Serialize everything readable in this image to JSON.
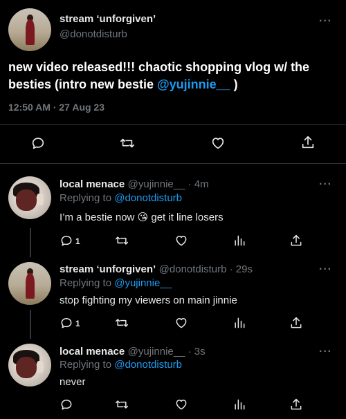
{
  "main_tweet": {
    "display_name": "stream ‘unforgiven’",
    "handle": "@donotdisturb",
    "text_before": "new video released!!! chaotic shopping vlog w/ the besties (intro new bestie ",
    "mention": "@yujinnie__",
    "text_after": " )",
    "timestamp": "12:50 AM · 27 Aug 23"
  },
  "replies": [
    {
      "display_name": "local menace",
      "meta": "@yujinnie__ · 4m",
      "replying_label": "Replying to ",
      "replying_to": "@donotdisturb",
      "text": "I’m a bestie now 😘  get it line losers",
      "reply_count": "1"
    },
    {
      "display_name": "stream ‘unforgiven’",
      "meta": "@donotdisturb · 29s",
      "replying_label": "Replying to ",
      "replying_to": "@yujinnie__",
      "text": "stop fighting my viewers on main jinnie",
      "reply_count": "1"
    },
    {
      "display_name": "local menace",
      "meta": "@yujinnie__ · 3s",
      "replying_label": "Replying to ",
      "replying_to": "@donotdisturb",
      "text": "never",
      "reply_count": ""
    }
  ],
  "more_label": "···",
  "icons": {
    "reply": "reply-icon",
    "retweet": "retweet-icon",
    "like": "heart-icon",
    "views": "views-icon",
    "share": "share-icon",
    "more": "more-icon"
  },
  "colors": {
    "background": "#000000",
    "text": "#e7e9ea",
    "secondary": "#71767b",
    "link": "#1d9bf0",
    "divider": "#2f3336"
  }
}
